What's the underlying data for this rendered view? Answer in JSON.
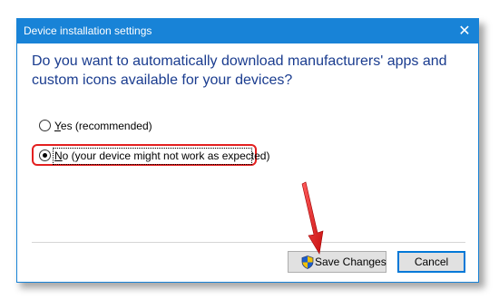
{
  "window": {
    "title": "Device installation settings",
    "close_glyph": "✕"
  },
  "question": "Do you want to automatically download manufacturers' apps and custom icons available for your devices?",
  "options": [
    {
      "prefix": "Y",
      "rest": "es (recommended)",
      "selected": false
    },
    {
      "prefix": "N",
      "rest": "o (your device might not work as expected)",
      "selected": true
    }
  ],
  "buttons": {
    "save_label": "Save Changes",
    "save_icon": "shield-icon",
    "cancel_label": "Cancel"
  },
  "colors": {
    "titlebar": "#1883d7",
    "question_text": "#1a3c8f",
    "highlight": "#e32020",
    "arrow": "#e32020"
  }
}
